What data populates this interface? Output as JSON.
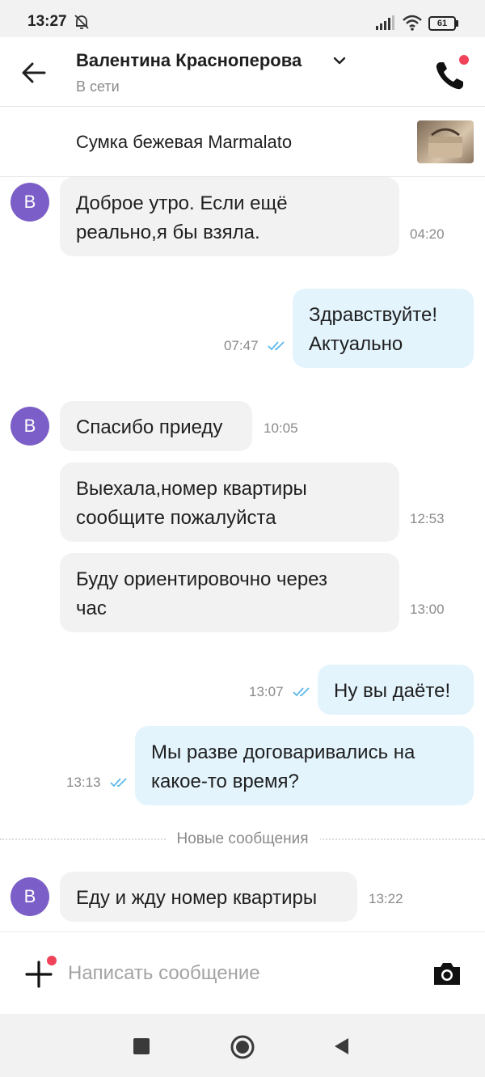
{
  "status_bar": {
    "time": "13:27",
    "battery": "61"
  },
  "header": {
    "contact_name": "Валентина Красноперова",
    "contact_status": "В сети"
  },
  "product": {
    "title": "Сумка бежевая Marmalato"
  },
  "messages": [
    {
      "direction": "in",
      "avatar": "В",
      "text_lines": [
        "Доброе утро. Если ещё",
        "реально,я бы взяла."
      ],
      "time": "04:20"
    },
    {
      "direction": "out",
      "text_lines": [
        "Здравствуйте!",
        "Актуально"
      ],
      "time": "07:47",
      "status": "read"
    },
    {
      "direction": "in",
      "avatar": "В",
      "text_lines": [
        "Спасибо приеду"
      ],
      "time": "10:05"
    },
    {
      "direction": "in",
      "text_lines": [
        "Выехала,номер квартиры",
        "сообщите пожалуйста"
      ],
      "time": "12:53"
    },
    {
      "direction": "in",
      "text_lines": [
        "Буду ориентировочно через",
        "час"
      ],
      "time": "13:00"
    },
    {
      "direction": "out",
      "text_lines": [
        "Ну вы даёте!"
      ],
      "time": "13:07",
      "status": "read"
    },
    {
      "direction": "out",
      "text_lines": [
        "Мы разве договаривались на",
        "какое-то время?"
      ],
      "time": "13:13",
      "status": "read"
    },
    {
      "direction": "in",
      "avatar": "В",
      "text_lines": [
        "Еду и жду номер квартиры"
      ],
      "time": "13:22"
    }
  ],
  "new_messages_divider": "Новые сообщения",
  "composer": {
    "placeholder": "Написать сообщение"
  },
  "colors": {
    "avatar": "#7b5ec7",
    "incoming_bubble": "#f2f2f2",
    "outgoing_bubble": "#e3f4fd",
    "read_ticks": "#5bb8e8",
    "notification_dot": "#f0435a"
  },
  "icons": [
    "back-arrow-icon",
    "chevron-down-icon",
    "phone-icon",
    "plus-icon",
    "camera-icon",
    "mute-bell-icon",
    "signal-icon",
    "wifi-icon",
    "double-check-icon",
    "nav-recents-icon",
    "nav-home-icon",
    "nav-back-icon"
  ]
}
